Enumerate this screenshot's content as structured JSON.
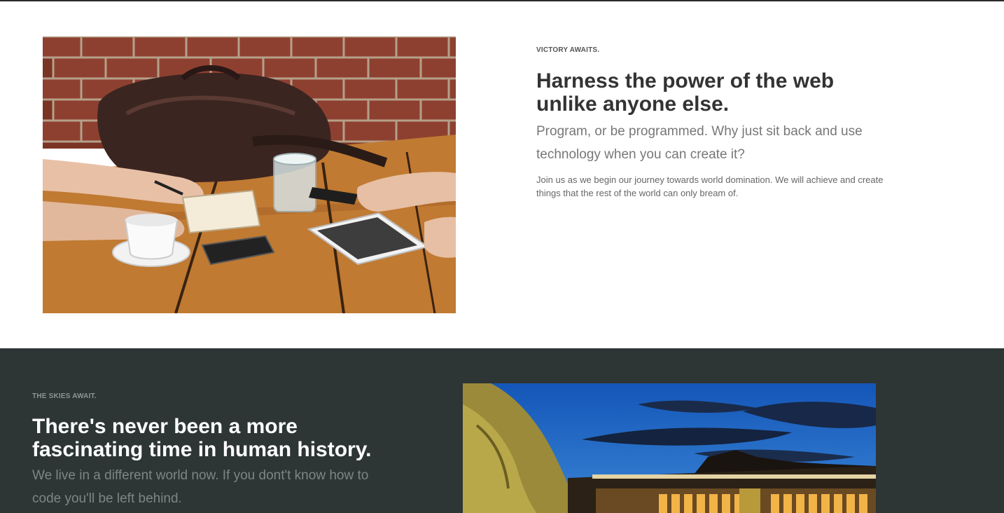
{
  "section1": {
    "eyebrow": "VICTORY AWAITS.",
    "title": "Harness the power of the web unlike anyone else.",
    "lead": "Program, or be programmed. Why just sit back and use technology when you can create it?",
    "body": "Join us as we begin our journey towards world domination. We will achieve and create things that the rest of the world can only bream of.",
    "image_icon": "meeting-table-photo"
  },
  "section2": {
    "eyebrow": "THE SKIES AWAIT.",
    "title": "There's never been a more fascinating time in human history.",
    "lead": "We live in a different world now. If you dont't know how to code you'll be left behind.",
    "image_icon": "desert-building-dusk-photo"
  },
  "colors": {
    "dark_section_bg": "#2d3535",
    "heading_dark": "#333333",
    "muted_text": "#777777"
  }
}
